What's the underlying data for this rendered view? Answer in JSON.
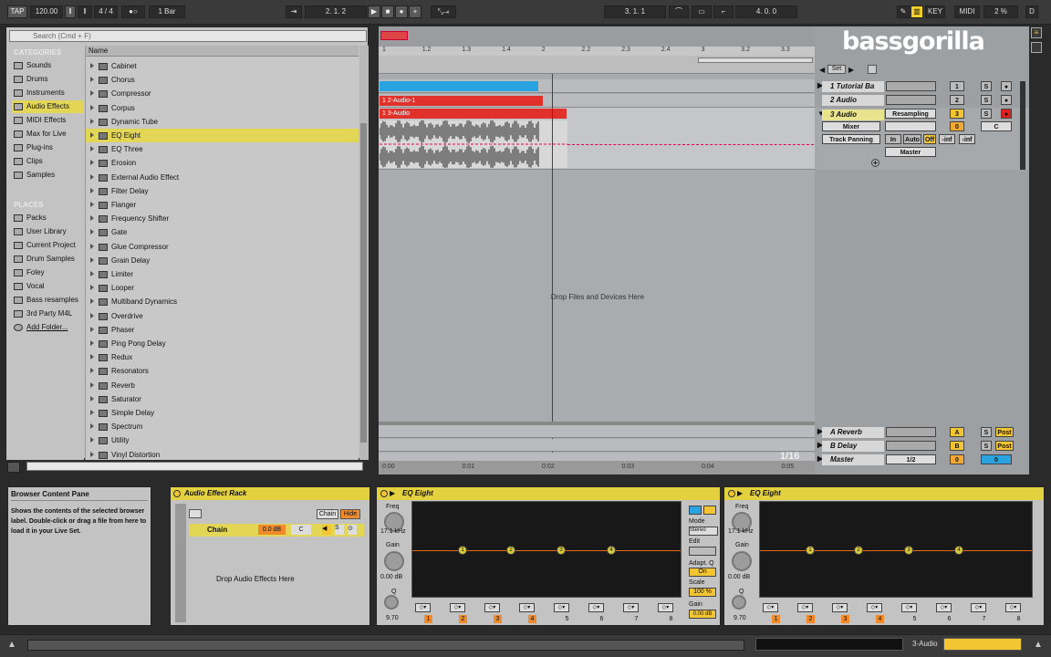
{
  "topbar": {
    "tap": "TAP",
    "tempo": "120.00",
    "signature": "4 / 4",
    "metronome": "●○",
    "quantize": "1 Bar",
    "position": "2.   1.   2",
    "loop_start": "3.   1.   1",
    "loop_length": "4.   0.   0",
    "key": "KEY",
    "midi": "MIDI",
    "cpu": "2 %",
    "d": "D"
  },
  "browser": {
    "search_placeholder": "Search (Cmd + F)",
    "categories_title": "CATEGORIES",
    "places_title": "PLACES",
    "column_name": "Name",
    "categories": [
      "Sounds",
      "Drums",
      "Instruments",
      "Audio Effects",
      "MIDI Effects",
      "Max for Live",
      "Plug-ins",
      "Clips",
      "Samples"
    ],
    "places": [
      "Packs",
      "User Library",
      "Current Project",
      "Drum Samples",
      "Foley",
      "Vocal",
      "Bass resamples",
      "3rd Party M4L",
      "Add Folder..."
    ],
    "items": [
      "Cabinet",
      "Chorus",
      "Compressor",
      "Corpus",
      "Dynamic Tube",
      "EQ Eight",
      "EQ Three",
      "Erosion",
      "External Audio Effect",
      "Filter Delay",
      "Flanger",
      "Frequency Shifter",
      "Gate",
      "Glue Compressor",
      "Grain Delay",
      "Limiter",
      "Looper",
      "Multiband Dynamics",
      "Overdrive",
      "Phaser",
      "Ping Pong Delay",
      "Redux",
      "Resonators",
      "Reverb",
      "Saturator",
      "Simple Delay",
      "Spectrum",
      "Utility",
      "Vinyl Distortion"
    ]
  },
  "arrangement": {
    "ruler": [
      "1",
      "1.2",
      "1.3",
      "1.4",
      "2",
      "2.2",
      "2.3",
      "2.4",
      "3",
      "3.2",
      "3.3"
    ],
    "clips": [
      "1 2-Audio-1",
      "1 3-Audio"
    ],
    "drop_text": "Drop Files and Devices Here",
    "time_labels": [
      "0:00",
      "0:01",
      "0:02",
      "0:03",
      "0:04",
      "0:05"
    ],
    "quant_label": "1/16",
    "set_label": "Set"
  },
  "mixer": {
    "tracks": [
      {
        "name": "1 Tutorial Ba",
        "num": "1",
        "s": "S"
      },
      {
        "name": "2 Audio",
        "num": "2",
        "s": "S"
      },
      {
        "name": "3 Audio",
        "num": "3",
        "s": "S"
      }
    ],
    "resampling": "Resampling",
    "mixer_label": "Mixer",
    "track_panning": "Track Panning",
    "master_out": "Master",
    "in": "In",
    "auto": "Auto",
    "off": "Off",
    "inf1": "-inf",
    "inf2": "-inf",
    "c": "C",
    "returns": [
      {
        "name": "A Reverb",
        "letter": "A",
        "post": "Post"
      },
      {
        "name": "B Delay",
        "letter": "B",
        "post": "Post"
      },
      {
        "name": "Master",
        "letter": "",
        "post": ""
      }
    ],
    "master_ratio": "1/2",
    "zero": "0"
  },
  "brand": {
    "logo_text": "bassgorilla"
  },
  "info": {
    "title": "Browser Content Pane",
    "text": "Shows the contents of the selected browser label. Double-click or drag a file from here to load it in your Live Set."
  },
  "rack": {
    "title": "Audio Effect Rack",
    "chain_btn": "Chain",
    "hide_btn": "Hide",
    "chain_name": "Chain",
    "chain_vol": "0.0 dB",
    "chain_pan": "C",
    "drop_text": "Drop Audio Effects Here"
  },
  "eq1": {
    "title": "EQ Eight",
    "freq_label": "Freq",
    "freq_value": "17.1 kHz",
    "gain_label": "Gain",
    "gain_value": "0.00 dB",
    "q_label": "Q",
    "q_value": "9.70",
    "mode_label": "Mode",
    "mode_value": "Stereo",
    "edit_label": "Edit",
    "adapt_label": "Adapt. Q",
    "adapt_value": "On",
    "scale_label": "Scale",
    "scale_value": "100 %",
    "gain2_label": "Gain",
    "gain2_value": "0.00 dB",
    "bands": [
      "1",
      "2",
      "3",
      "4",
      "5",
      "6",
      "7",
      "8"
    ]
  },
  "eq2": {
    "title": "EQ Eight",
    "freq_label": "Freq",
    "freq_value": "17.1 kHz",
    "gain_label": "Gain",
    "gain_value": "0.00 dB",
    "q_label": "Q",
    "q_value": "9.70",
    "bands": [
      "1",
      "2",
      "3",
      "4",
      "5",
      "6",
      "7",
      "8"
    ]
  },
  "status": {
    "track_label": "3-Audio"
  },
  "colors": {
    "selection": "#e3d656",
    "clip_blue": "#29a3e0",
    "clip_red": "#e0322b",
    "device_header": "#e3d140"
  }
}
